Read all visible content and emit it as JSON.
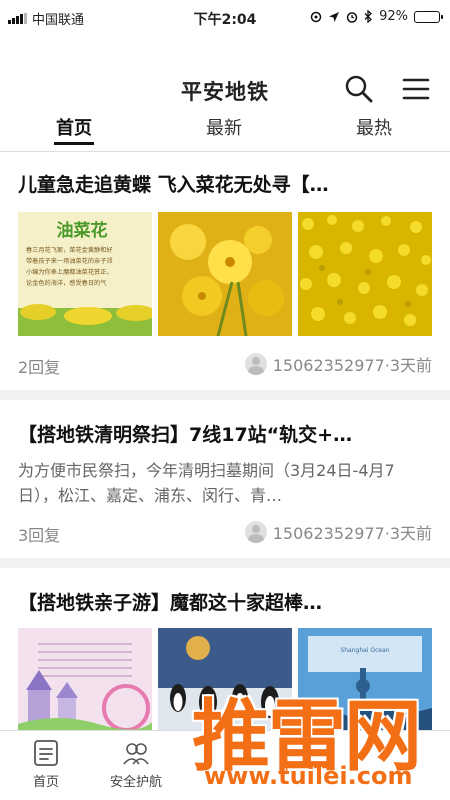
{
  "status_bar": {
    "carrier": "中国联通",
    "time": "下午2:04",
    "battery_percent": "92%",
    "battery_level": 0.92
  },
  "header": {
    "title": "平安地铁",
    "tabs": [
      {
        "label": "首页",
        "active": true
      },
      {
        "label": "最新",
        "active": false
      },
      {
        "label": "最热",
        "active": false
      }
    ]
  },
  "articles": [
    {
      "title": "儿童急走追黄蝶 飞入菜花无处寻【…",
      "replies": "2回复",
      "author_time": "15062352977·3天前",
      "thumbnails": [
        "poster-icon",
        "flower-icon",
        "field-icon"
      ],
      "poster_heading": "油菜花",
      "poster_text": "春三月花飞絮，菜花金黄静和好带着孩子来一场油菜花的亲子郊小编为你奉上魔都油菜花赏正，论金色的海洋，感受春日的气"
    },
    {
      "title": "【搭地铁清明祭扫】7线17站“轨交+…",
      "summary": "为方便市民祭扫，今年清明扫墓期间（3月24日-4月7日），松江、嘉定、浦东、闵行、青…",
      "replies": "3回复",
      "author_time": "15062352977·3天前"
    },
    {
      "title": "【搭地铁亲子游】魔都这十家超棒…",
      "thumbnails": [
        "castle-icon",
        "penguin-icon",
        "tower-icon"
      ]
    }
  ],
  "bottom_nav": [
    {
      "label": "首页",
      "icon": "home-list-icon"
    },
    {
      "label": "安全护航",
      "icon": "people-icon"
    }
  ],
  "watermark": {
    "text": "推雷网",
    "url": "www.tuilei.com",
    "color": "#f26f16"
  },
  "colors": {
    "accent": "#111111",
    "flower_yellow": "#e8c200",
    "background": "#f2f2f2"
  }
}
